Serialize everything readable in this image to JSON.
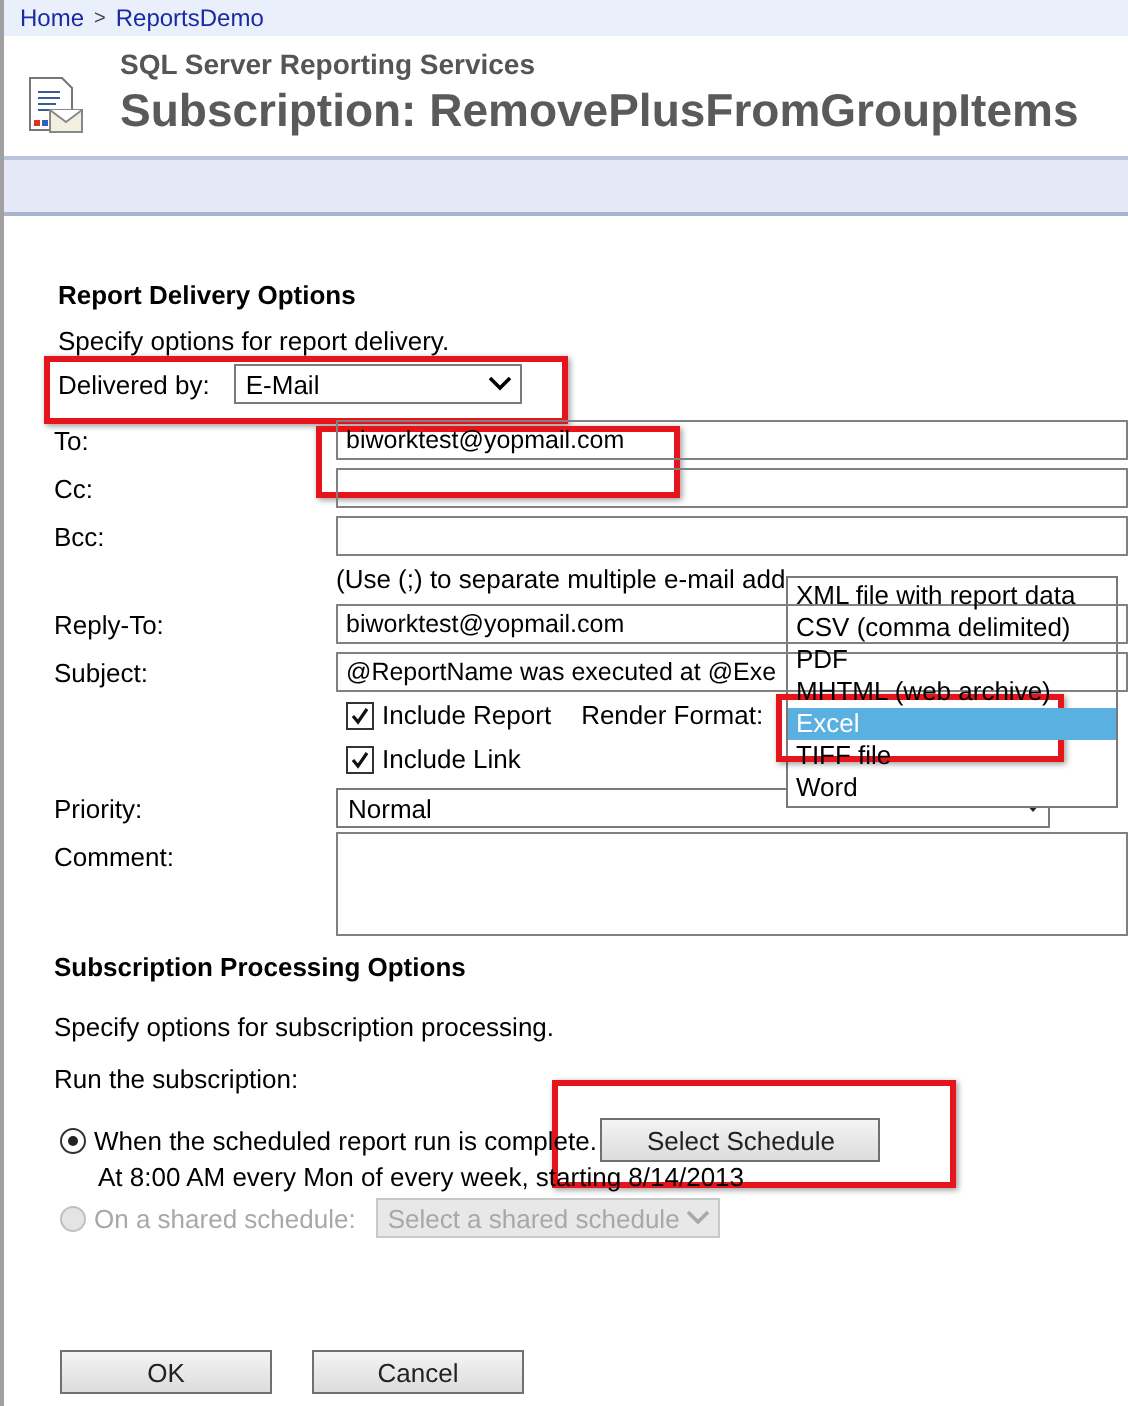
{
  "breadcrumb": {
    "items": [
      "Home",
      "ReportsDemo"
    ],
    "separator": ">"
  },
  "header": {
    "product": "SQL Server Reporting Services",
    "title": "Subscription: RemovePlusFromGroupItems"
  },
  "delivery": {
    "heading": "Report Delivery Options",
    "description": "Specify options for report delivery.",
    "delivered_by": {
      "label": "Delivered by:",
      "value": "E-Mail"
    },
    "fields": [
      {
        "kind": "input",
        "label": "To:",
        "value": "biworktest@yopmail.com"
      },
      {
        "kind": "input",
        "label": "Cc:"
      },
      {
        "kind": "input",
        "label": "Bcc:"
      },
      {
        "kind": "hint",
        "text": "(Use (;) to separate multiple e-mail add"
      },
      {
        "kind": "input",
        "label": "Reply-To:",
        "value": "biworktest@yopmail.com"
      },
      {
        "kind": "input",
        "label": "Subject:",
        "value": "@ReportName was executed at @Exe"
      },
      {
        "kind": "checkbox",
        "text": "Include Report",
        "checked": true,
        "extra_label": "Render Format:"
      },
      {
        "kind": "checkbox",
        "text": "Include Link",
        "checked": true
      },
      {
        "kind": "select",
        "label": "Priority:",
        "value": "Normal"
      },
      {
        "kind": "textarea",
        "label": "Comment:"
      }
    ],
    "render_format_options": [
      {
        "label": "XML file with report data",
        "selected": false
      },
      {
        "label": "CSV (comma delimited)",
        "selected": false
      },
      {
        "label": "PDF",
        "selected": false
      },
      {
        "label": "MHTML (web archive)",
        "selected": false
      },
      {
        "label": "Excel",
        "selected": true
      },
      {
        "label": "TIFF file",
        "selected": false
      },
      {
        "label": "Word",
        "selected": false
      }
    ]
  },
  "processing": {
    "heading": "Subscription Processing Options",
    "description": "Specify options for subscription processing.",
    "run_label": "Run the subscription:",
    "options": [
      {
        "label": "When the scheduled report run is complete.",
        "selected": true,
        "disabled": false,
        "button": "Select Schedule",
        "detail": "At 8:00 AM every Mon of every week, starting 8/14/2013"
      },
      {
        "label": "On a shared schedule:",
        "selected": false,
        "disabled": true,
        "select_placeholder": "Select a shared schedule"
      }
    ]
  },
  "buttons": [
    "OK",
    "Cancel"
  ]
}
